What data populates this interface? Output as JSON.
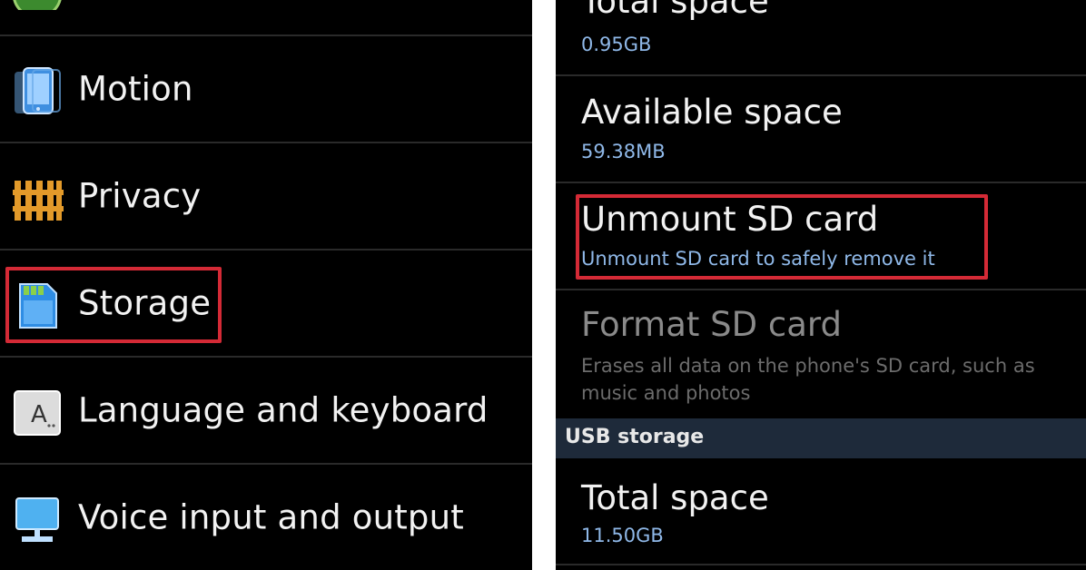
{
  "left_menu": {
    "items": [
      {
        "label": "Motion",
        "icon": "motion-icon"
      },
      {
        "label": "Privacy",
        "icon": "privacy-icon"
      },
      {
        "label": "Storage",
        "icon": "storage-icon"
      },
      {
        "label": "Language and keyboard",
        "icon": "keyboard-icon"
      },
      {
        "label": "Voice input and output",
        "icon": "voice-io-icon"
      }
    ]
  },
  "storage_details": {
    "sd_total": {
      "title": "Total space",
      "value": "0.95GB"
    },
    "sd_available": {
      "title": "Available space",
      "value": "59.38MB"
    },
    "unmount": {
      "title": "Unmount SD card",
      "subtitle": "Unmount SD card to safely remove it"
    },
    "format": {
      "title": "Format SD card",
      "subtitle": "Erases all data on the phone's SD card, such as music and photos"
    },
    "usb_header": "USB storage",
    "usb_total": {
      "title": "Total space",
      "value": "11.50GB"
    }
  },
  "colors": {
    "highlight": "#d42a36",
    "subtitle_blue": "#8fb8e8",
    "background": "#000000"
  }
}
